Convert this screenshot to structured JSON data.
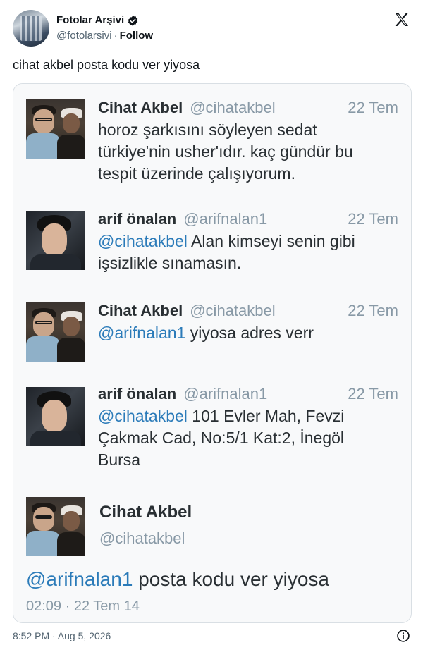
{
  "author": {
    "name": "Fotolar Arşivi",
    "handle": "@fotolarsivi",
    "separator": "·",
    "follow_label": "Follow",
    "verified_icon": "verified-badge-icon"
  },
  "brand_icon": "x-logo-icon",
  "tweet": {
    "text": "cihat akbel posta kodu ver yiyosa"
  },
  "screenshot": {
    "thread": [
      {
        "name": "Cihat Akbel",
        "handle": "@cihatakbel",
        "date": "22 Tem",
        "lines": [
          "horoz şarkısını söyleyen sedat",
          "türkiye'nin usher'ıdır. kaç gündür bu",
          "tespit üzerinde çalışıyorum."
        ]
      },
      {
        "name": "arif önalan",
        "handle": "@arifnalan1",
        "date": "22 Tem",
        "mention": "@cihatakbel",
        "line1_rest": " Alan kimseyi senin gibi",
        "line2": "işsizlikle sınamasın."
      },
      {
        "name": "Cihat Akbel",
        "handle": "@cihatakbel",
        "date": "22 Tem",
        "mention": "@arifnalan1",
        "line1_rest": " yiyosa adres verr"
      },
      {
        "name": "arif önalan",
        "handle": "@arifnalan1",
        "date": "22 Tem",
        "mention": "@cihatakbel",
        "line1_rest": " 101 Evler Mah, Fevzi",
        "line2": "Çakmak Cad, No:5/1 Kat:2, İnegöl",
        "line3": "Bursa"
      }
    ],
    "final": {
      "name": "Cihat Akbel",
      "handle": "@cihatakbel",
      "mention": "@arifnalan1",
      "text_rest": " posta kodu ver yiyosa",
      "meta": "02:09 · 22 Tem 14"
    }
  },
  "footer": {
    "timestamp": "8:52 PM · Aug 5, 2026",
    "info_icon": "info-icon"
  },
  "colors": {
    "mention": "#2b7bb9",
    "muted": "#8899a6",
    "text": "#0f1419"
  }
}
